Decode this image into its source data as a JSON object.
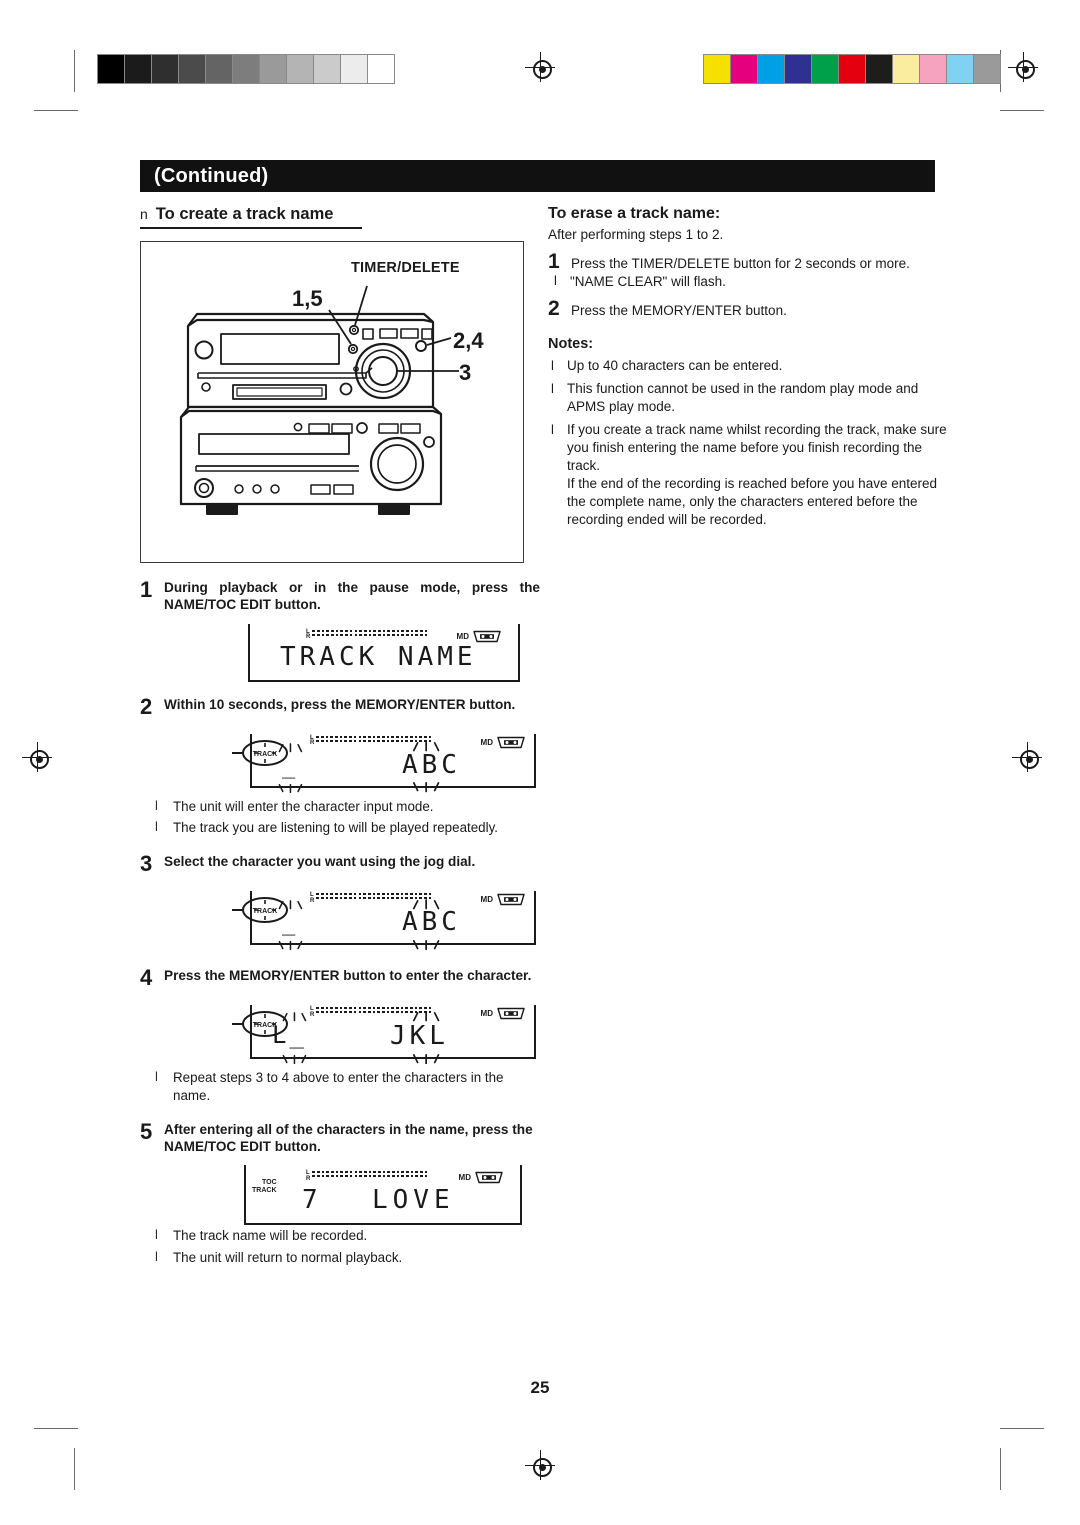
{
  "page": {
    "number": "25",
    "continued_label": "(Continued)"
  },
  "print_marks": {
    "grayscale_patches": [
      "#000000",
      "#1b1b1b",
      "#2f2f2f",
      "#4b4b4b",
      "#646464",
      "#7d7d7d",
      "#9a9a9a",
      "#b4b4b4",
      "#cbcbcb",
      "#ececec",
      "#ffffff"
    ],
    "color_patches": [
      "#f5e100",
      "#e5007d",
      "#00a0e4",
      "#2e3192",
      "#00a04a",
      "#e3000f",
      "#1d1d1b",
      "#faeda0",
      "#f5a3bf",
      "#7fd2f2",
      "#9a9a9a"
    ]
  },
  "left_column": {
    "section_bullet": "n",
    "section_title": "To create a track name",
    "figure": {
      "callout_timer_delete": "TIMER/DELETE",
      "callout_1_5": "1,5",
      "callout_2_4": "2,4",
      "callout_3": "3"
    },
    "steps": [
      {
        "number": "1",
        "text": "During playback or in the pause mode, press the NAME/TOC EDIT button.",
        "justify": true,
        "display": {
          "kind": "track-name",
          "left_indicators": [],
          "level_left": "L",
          "level_right": "R",
          "md_label": "MD",
          "main_text": "TRACK NAME"
        },
        "bullets": []
      },
      {
        "number": "2",
        "text": "Within 10 seconds, press the MEMORY/ENTER button.",
        "justify": false,
        "display": {
          "kind": "abc-blink",
          "left_indicators": [
            "TRACK"
          ],
          "level_left": "L",
          "level_right": "R",
          "md_label": "MD",
          "cursor_char": "_",
          "main_text": "ABC"
        },
        "bullets": [
          "The unit will enter the character input mode.",
          "The track you are listening to will be played repeatedly."
        ]
      },
      {
        "number": "3",
        "text": "Select the character you want using the jog dial.",
        "justify": false,
        "display": {
          "kind": "abc-blink",
          "left_indicators": [
            "TRACK"
          ],
          "level_left": "L",
          "level_right": "R",
          "md_label": "MD",
          "cursor_char": "_",
          "main_text": "ABC"
        },
        "bullets": []
      },
      {
        "number": "4",
        "text": "Press the MEMORY/ENTER button to enter the character.",
        "justify": false,
        "display": {
          "kind": "jkl-blink",
          "left_indicators": [
            "TRACK"
          ],
          "level_left": "L",
          "level_right": "R",
          "md_label": "MD",
          "entered_text": "L_",
          "main_text": "JKL"
        },
        "bullets": [
          "Repeat steps 3 to 4 above to enter the characters in the name."
        ]
      },
      {
        "number": "5",
        "text": "After entering all of the characters in the name, press the NAME/TOC EDIT button.",
        "justify": false,
        "display": {
          "kind": "final",
          "left_indicators": [
            "TOC",
            "TRACK"
          ],
          "level_left": "L",
          "level_right": "R",
          "md_label": "MD",
          "track_number": "7",
          "main_text": "LOVE"
        },
        "bullets": [
          "The track name will be recorded.",
          "The unit will return to normal playback."
        ]
      }
    ]
  },
  "right_column": {
    "erase_title": "To erase a track name:",
    "erase_subtitle": "After performing steps 1 to 2.",
    "erase_steps": [
      {
        "number": "1",
        "text": "Press the TIMER/DELETE button for 2 seconds or more."
      },
      {
        "number": "2",
        "text": "Press the MEMORY/ENTER button."
      }
    ],
    "erase_bullet": "\"NAME CLEAR\" will flash.",
    "notes_title": "Notes:",
    "notes": [
      [
        "Up to 40 characters can be entered."
      ],
      [
        "This function cannot be used in the random play mode and APMS play mode."
      ],
      [
        "If you create a track name whilst recording the track, make sure you finish entering the name before you finish recording the track.",
        "If the end of the recording is reached before you have entered the complete name, only the characters entered before the recording ended will be recorded."
      ]
    ]
  }
}
